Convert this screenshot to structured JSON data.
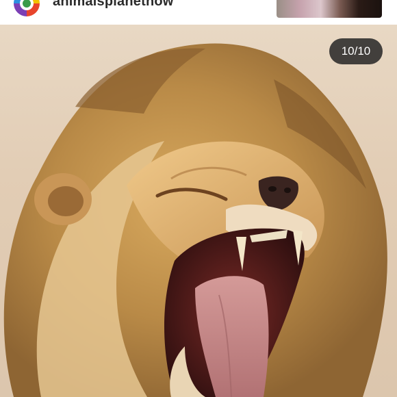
{
  "header": {
    "username": "animalsplanetnow",
    "avatar_icon": "rainbow-globe-avatar",
    "story_thumbnail": "story-thumbnail-preview"
  },
  "post": {
    "image_subject": "roaring-lion-photo",
    "counter": "10/10",
    "colors": {
      "background": "#e4d2bd",
      "mane": "#b3823f",
      "mouth": "#5a1c1c",
      "tongue": "#c98587",
      "counter_bg": "#262626"
    }
  }
}
